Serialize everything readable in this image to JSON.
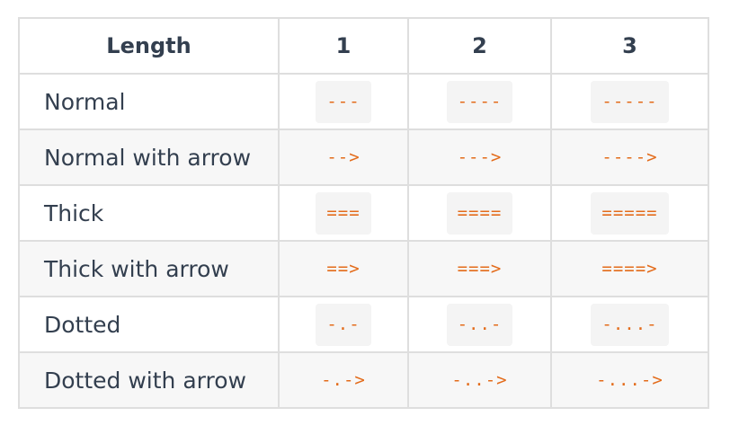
{
  "table": {
    "headers": [
      "Length",
      "1",
      "2",
      "3"
    ],
    "rows": [
      {
        "label": "Normal",
        "values": [
          "---",
          "----",
          "-----"
        ],
        "boxed": true
      },
      {
        "label": "Normal with arrow",
        "values": [
          "-->",
          "--->",
          "---->"
        ],
        "boxed": false
      },
      {
        "label": "Thick",
        "values": [
          "===",
          "====",
          "====="
        ],
        "boxed": true
      },
      {
        "label": "Thick with arrow",
        "values": [
          "==>",
          "===>",
          "====>"
        ],
        "boxed": false
      },
      {
        "label": "Dotted",
        "values": [
          "-.-",
          "-..-",
          "-...-"
        ],
        "boxed": true
      },
      {
        "label": "Dotted with arrow",
        "values": [
          "-.->",
          "-..->",
          "-...->"
        ],
        "boxed": false
      }
    ]
  },
  "colors": {
    "code_text": "#e36b1a",
    "body_text": "#333f4f",
    "border": "#dedede",
    "stripe_bg": "#f7f7f7",
    "code_bg": "#f4f4f4"
  }
}
